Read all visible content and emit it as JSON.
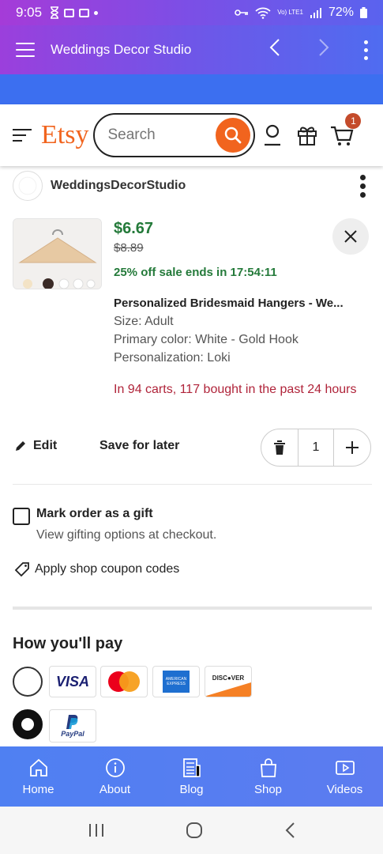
{
  "status_bar": {
    "time": "9:05",
    "battery": "72%",
    "network": "Vo) LTE1"
  },
  "app_bar": {
    "title": "Weddings Decor Studio"
  },
  "etsy": {
    "logo": "Etsy",
    "search_placeholder": "Search",
    "cart_count": "1"
  },
  "shop": {
    "name": "WeddingsDecorStudio"
  },
  "item": {
    "price": "$6.67",
    "original_price": "$8.89",
    "sale_text": "25% off sale ends in 17:54:11",
    "title": "Personalized Bridesmaid Hangers - We...",
    "size": "Size: Adult",
    "color": "Primary color: White - Gold Hook",
    "personalization": "Personalization: Loki",
    "scarcity": "In 94 carts, 117 bought in the past 24 hours",
    "quantity": "1"
  },
  "actions": {
    "edit": "Edit",
    "save_later": "Save for later"
  },
  "gift": {
    "label": "Mark order as a gift",
    "sub": "View gifting options at checkout."
  },
  "coupon": {
    "label": "Apply shop coupon codes"
  },
  "payment": {
    "title": "How you'll pay",
    "cards": {
      "visa": "VISA",
      "amex": "AMERICAN EXPRESS",
      "discover": "DISC●VER",
      "paypal": "PayPal"
    }
  },
  "tabs": [
    {
      "label": "Home",
      "icon": "home-icon"
    },
    {
      "label": "About",
      "icon": "info-icon"
    },
    {
      "label": "Blog",
      "icon": "newspaper-icon"
    },
    {
      "label": "Shop",
      "icon": "bag-icon"
    },
    {
      "label": "Videos",
      "icon": "video-icon"
    }
  ],
  "colors": {
    "etsy_orange": "#f1641e",
    "price_green": "#247a3a",
    "scarcity_red": "#b0243a",
    "tab_blue": "#5c7bf0"
  }
}
